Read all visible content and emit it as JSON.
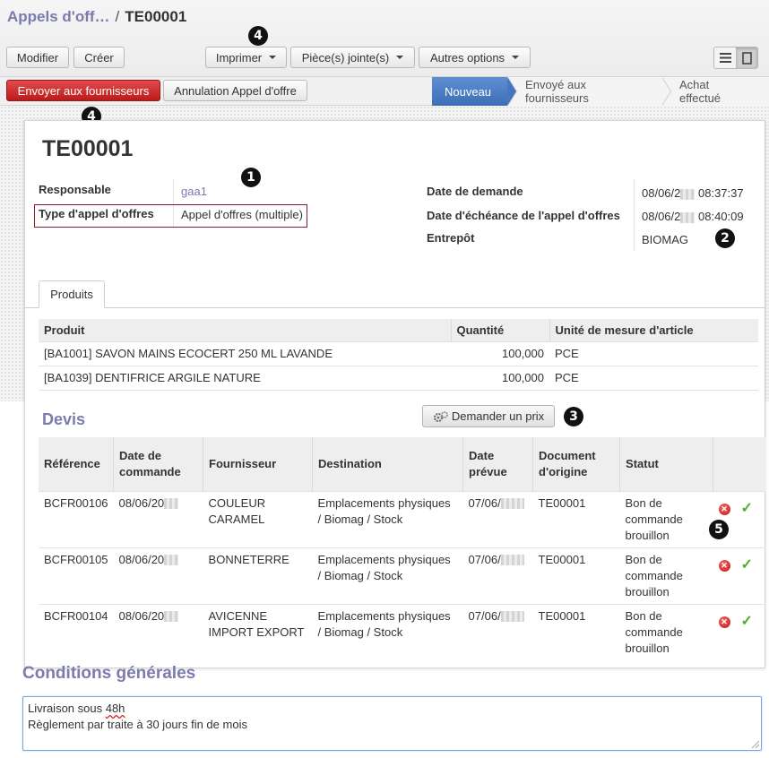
{
  "breadcrumb": {
    "parent": "Appels d'off…",
    "separator": "/",
    "current": "TE00001"
  },
  "toolbar": {
    "edit_label": "Modifier",
    "create_label": "Créer",
    "print_label": "Imprimer",
    "attachments_label": "Pièce(s) jointe(s)",
    "more_label": "Autres options"
  },
  "actions": {
    "send_label": "Envoyer aux fournisseurs",
    "cancel_label": "Annulation Appel d'offre"
  },
  "statusbar": {
    "stages": [
      "Nouveau",
      "Envoyé aux fournisseurs",
      "Achat effectué"
    ],
    "active_index": 0
  },
  "callouts": {
    "one": "1",
    "two": "2",
    "three": "3",
    "four": "4",
    "five": "5"
  },
  "record": {
    "title": "TE00001",
    "responsible_label": "Responsable",
    "responsible_value": "gaa1",
    "type_label": "Type d'appel d'offres",
    "type_value": "Appel d'offres (multiple)",
    "request_date_label": "Date de demande",
    "request_date_value": "08/06/2",
    "request_date_time": "08:37:37",
    "deadline_label": "Date d'échéance de l'appel d'offres",
    "deadline_value": "08/06/2",
    "deadline_time": "08:40:09",
    "warehouse_label": "Entrepôt",
    "warehouse_value": "BIOMAG"
  },
  "tabs": {
    "products": "Produits"
  },
  "products": {
    "headers": [
      "Produit",
      "Quantité",
      "Unité de mesure d'article"
    ],
    "rows": [
      [
        "[BA1001] SAVON MAINS ECOCERT 250 ML LAVANDE",
        "100,000",
        "PCE"
      ],
      [
        "[BA1039] DENTIFRICE ARGILE NATURE",
        "100,000",
        "PCE"
      ]
    ]
  },
  "quotes": {
    "title": "Devis",
    "request_price_label": "Demander un prix",
    "headers": {
      "reference": "Référence",
      "order_date_1": "Date de",
      "order_date_2": "commande",
      "supplier": "Fournisseur",
      "destination": "Destination",
      "planned_1": "Date",
      "planned_2": "prévue",
      "origin_1": "Document",
      "origin_2": "d'origine",
      "status": "Statut"
    },
    "rows": [
      {
        "ref": "BCFR00106",
        "date": "08/06/20",
        "supplier_1": "COULEUR",
        "supplier_2": "CARAMEL",
        "dest_1": "Emplacements physiques",
        "dest_2": "/ Biomag / Stock",
        "planned": "07/06/",
        "origin": "TE00001",
        "status_1": "Bon de",
        "status_2": "commande",
        "status_3": "brouillon"
      },
      {
        "ref": "BCFR00105",
        "date": "08/06/20",
        "supplier_1": "BONNETERRE",
        "supplier_2": "",
        "dest_1": "Emplacements physiques",
        "dest_2": "/ Biomag / Stock",
        "planned": "07/06/",
        "origin": "TE00001",
        "status_1": "Bon de",
        "status_2": "commande",
        "status_3": "brouillon"
      },
      {
        "ref": "BCFR00104",
        "date": "08/06/20",
        "supplier_1": "AVICENNE",
        "supplier_2": "IMPORT EXPORT",
        "dest_1": "Emplacements physiques",
        "dest_2": "/ Biomag / Stock",
        "planned": "07/06/",
        "origin": "TE00001",
        "status_1": "Bon de",
        "status_2": "commande",
        "status_3": "brouillon"
      }
    ]
  },
  "conditions": {
    "title": "Conditions générales",
    "line1_pre": "Livraison sous ",
    "line1_word": "48h",
    "line2": "Règlement par traite à 30 jours fin de mois"
  }
}
